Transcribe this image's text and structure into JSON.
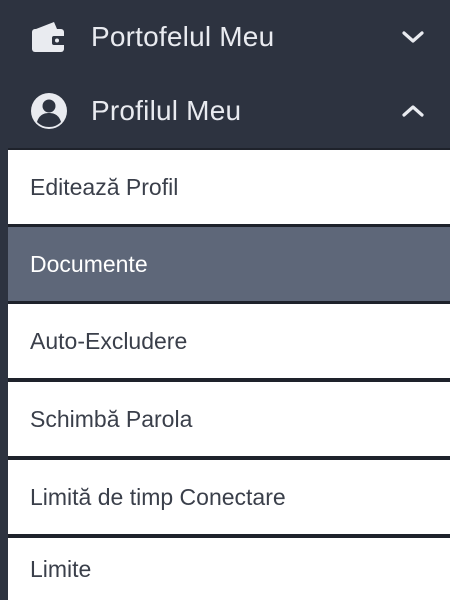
{
  "menu": {
    "wallet": {
      "label": "Portofelul Meu",
      "icon": "wallet-icon",
      "expanded": false
    },
    "profile": {
      "label": "Profilul Meu",
      "icon": "user-circle-icon",
      "expanded": true,
      "items": [
        {
          "label": "Editează Profil",
          "active": false
        },
        {
          "label": "Documente",
          "active": true
        },
        {
          "label": "Auto-Excludere",
          "active": false
        },
        {
          "label": "Schimbă Parola",
          "active": false
        },
        {
          "label": "Limită de timp Conectare",
          "active": false
        },
        {
          "label": "Limite",
          "active": false
        }
      ]
    }
  },
  "colors": {
    "header_bg": "#2d3340",
    "header_text": "#e9ebf0",
    "active_bg": "#5e6779",
    "item_bg": "#ffffff",
    "item_text": "#3a3f4a"
  }
}
